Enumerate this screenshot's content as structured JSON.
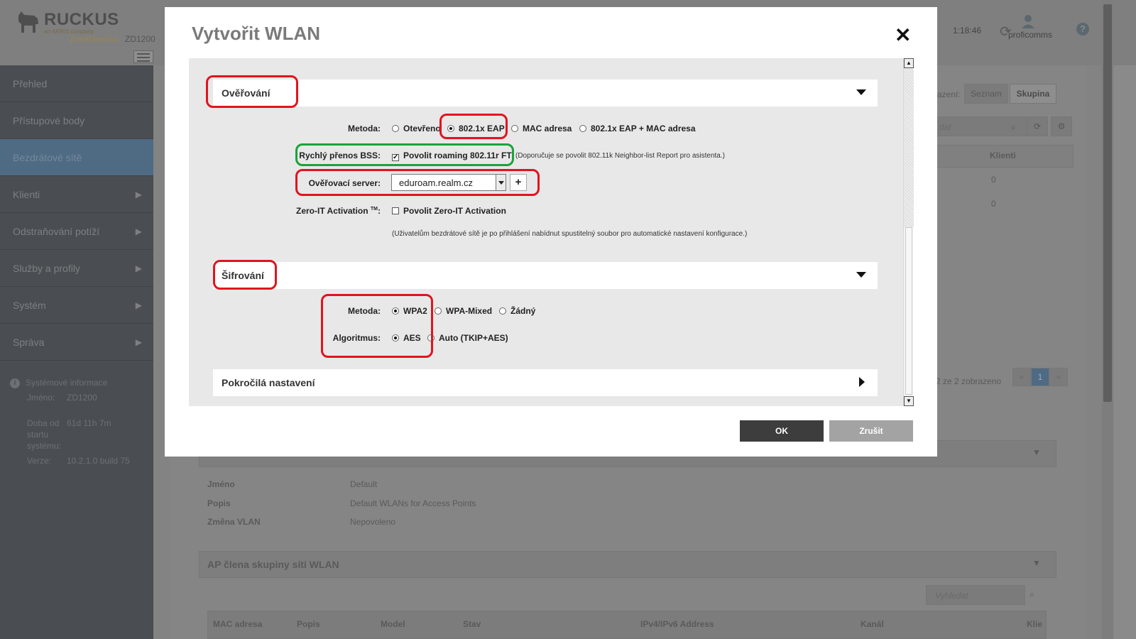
{
  "app": {
    "brand": "RUCKUS",
    "brand_sub": "an ARRIS company",
    "product": "ZoneDirector",
    "model": "ZD1200",
    "clock": "1:18:46",
    "user": "proficomms",
    "help": "?"
  },
  "sidebar": {
    "items": [
      {
        "label": "Přehled",
        "arrow": false
      },
      {
        "label": "Přístupové body",
        "arrow": false
      },
      {
        "label": "Bezdrátové sítě",
        "arrow": false,
        "active": true
      },
      {
        "label": "Klienti",
        "arrow": true
      },
      {
        "label": "Odstraňování potíží",
        "arrow": true
      },
      {
        "label": "Služby a profily",
        "arrow": true
      },
      {
        "label": "Systém",
        "arrow": true
      },
      {
        "label": "Správa",
        "arrow": true
      }
    ],
    "sysinfo": {
      "title": "Systémové informace",
      "name_label": "Jméno:",
      "name_value": "ZD1200",
      "uptime_label": "Doba od startu systému:",
      "uptime_value": "61d 11h 7m",
      "version_label": "Verze:",
      "version_value": "10.2.1.0 build 75"
    }
  },
  "background": {
    "view_label": "azení:",
    "view_list": "Seznam",
    "view_group": "Skupina",
    "search_placeholder": "dat",
    "clients_header": "Klienti",
    "clients_values": [
      "0",
      "0"
    ],
    "pagination_text": "2 ze 2 zobrazeno",
    "page_prev": "«",
    "page_current": "1",
    "page_next": "»",
    "details": [
      {
        "label": "Jméno",
        "value": "Default"
      },
      {
        "label": "Popis",
        "value": "Default WLANs for Access Points"
      },
      {
        "label": "Změna VLAN",
        "value": "Nepovoleno"
      }
    ],
    "ap_group_title": "AP člena skupiny sítí WLAN",
    "ap_search_placeholder": "Vyhledat",
    "table_headers": [
      "MAC adresa",
      "Popis",
      "Model",
      "Stav",
      "IPv4/IPv6 Address",
      "Kanál",
      "Klie"
    ]
  },
  "modal": {
    "title": "Vytvořit WLAN",
    "close": "✕",
    "auth": {
      "title": "Ověřování",
      "method_label": "Metoda:",
      "methods": [
        "Otevřeno",
        "802.1x EAP",
        "MAC adresa",
        "802.1x EAP + MAC adresa"
      ],
      "selected_method": "802.1x EAP",
      "fast_bss_label": "Rychlý přenos BSS:",
      "fast_bss_option": "Povolit roaming 802.11r FT",
      "fast_bss_checked": true,
      "fast_bss_hint": "(Doporučuje se povolit 802.11k Neighbor-list Report pro asistenta.)",
      "server_label": "Ověřovací server:",
      "server_value": "eduroam.realm.cz",
      "server_add": "+",
      "zeroit_label": "Zero-IT Activation",
      "zeroit_tm": "TM",
      "zeroit_colon": ":",
      "zeroit_option": "Povolit Zero-IT Activation",
      "zeroit_checked": false,
      "zeroit_hint": "(Uživatelům bezdrátové sítě je po přihlášení nabídnut spustitelný soubor pro automatické nastavení konfigurace.)"
    },
    "encryption": {
      "title": "Šifrování",
      "method_label": "Metoda:",
      "methods": [
        "WPA2",
        "WPA-Mixed",
        "Žádný"
      ],
      "selected_method": "WPA2",
      "algorithm_label": "Algoritmus:",
      "algorithms": [
        "AES",
        "Auto (TKIP+AES)"
      ],
      "selected_algorithm": "AES"
    },
    "advanced": {
      "title": "Pokročilá nastavení"
    },
    "buttons": {
      "ok": "OK",
      "cancel": "Zrušit"
    }
  },
  "colors": {
    "highlight_red": "#e0141e",
    "highlight_green": "#1aa33a",
    "sidebar_active": "#4f6b84"
  }
}
